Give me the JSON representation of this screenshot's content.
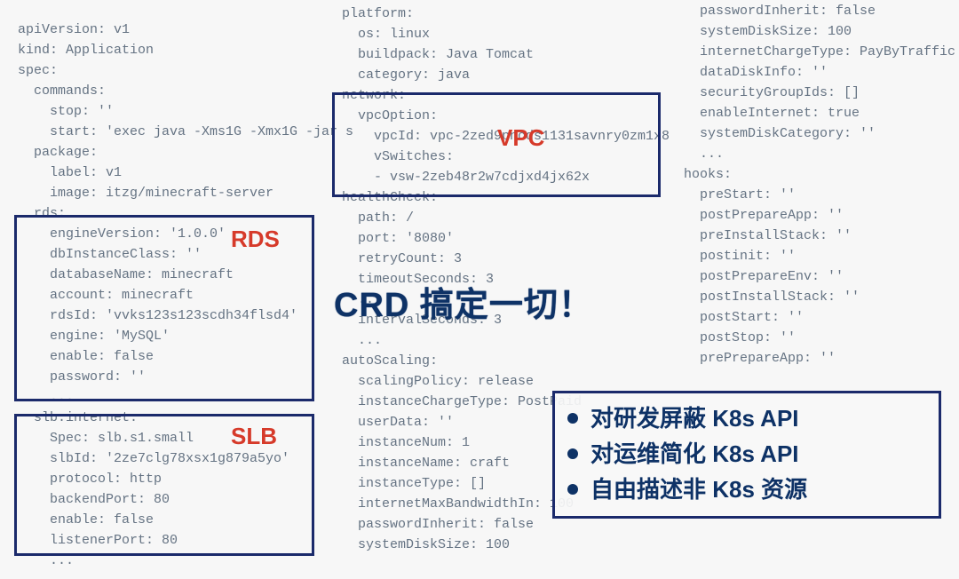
{
  "col1": [
    "apiVersion: v1",
    "kind: Application",
    "spec:",
    "  commands:",
    "    stop: ''",
    "    start: 'exec java -Xms1G -Xmx1G -jar s",
    "  package:",
    "    label: v1",
    "    image: itzg/minecraft-server",
    "  rds:",
    "    engineVersion: '1.0.0'",
    "    dbInstanceClass: ''",
    "    databaseName: minecraft",
    "    account: minecraft",
    "    rdsId: 'vvks123s123scdh34flsd4'",
    "    engine: 'MySQL'",
    "    enable: false",
    "    password: ''",
    "    ...",
    "  slb.internet:",
    "    Spec: slb.s1.small",
    "    slbId: '2ze7clg78xsx1g879a5yo'",
    "    protocol: http",
    "    backendPort: 80",
    "    enable: false",
    "    listenerPort: 80",
    "    ..."
  ],
  "col2": [
    "platform:",
    "  os: linux",
    "  buildpack: Java Tomcat",
    "  category: java",
    "network:",
    "  vpcOption:",
    "    vpcId: vpc-2zed9pncds1131savnry0zm1x8",
    "    vSwitches:",
    "    - vsw-2zeb48r2w7cdjxd4jx62x",
    "healthCheck:",
    "  path: /",
    "  port: '8080'",
    "  retryCount: 3",
    "  timeoutSeconds: 3",
    "  ...",
    "  intervalSeconds: 3",
    "  ...",
    "autoScaling:",
    "  scalingPolicy: release",
    "  instanceChargeType: PostPaid",
    "  userData: ''",
    "  instanceNum: 1",
    "  instanceName: craft",
    "  instanceType: []",
    "  internetMaxBandwidthIn: 100",
    "  passwordInherit: false",
    "  systemDiskSize: 100"
  ],
  "col3": [
    "  passwordInherit: false",
    "  systemDiskSize: 100",
    "  internetChargeType: PayByTraffic",
    "  dataDiskInfo: ''",
    "  securityGroupIds: []",
    "  enableInternet: true",
    "  systemDiskCategory: ''",
    "  ...",
    "hooks:",
    "  preStart: ''",
    "  postPrepareApp: ''",
    "  preInstallStack: ''",
    "  postinit: ''",
    "  postPrepareEnv: ''",
    "  postInstallStack: ''",
    "  postStart: ''",
    "  postStop: ''",
    "  prePrepareApp: ''"
  ],
  "labels": {
    "rds": "RDS",
    "slb": "SLB",
    "vpc": "VPC"
  },
  "headline": "CRD 搞定一切！",
  "bullets": [
    "对研发屏蔽 K8s API",
    "对运维简化 K8s API",
    "自由描述非 K8s 资源"
  ]
}
